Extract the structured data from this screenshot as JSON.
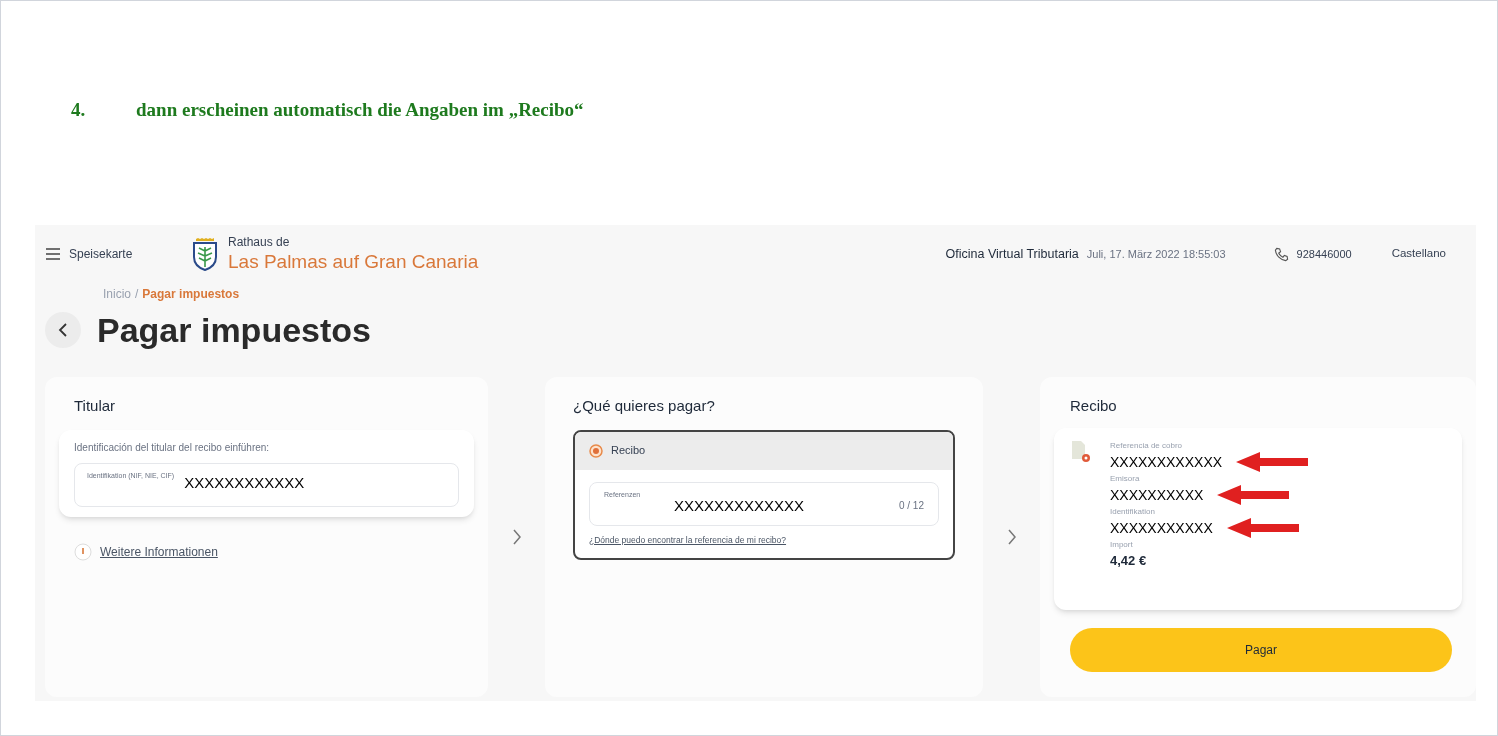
{
  "heading": {
    "number": "4.",
    "text": "dann erscheinen automatisch die Angaben im „Recibo“"
  },
  "header": {
    "menu_label": "Speisekarte",
    "logo_top": "Rathaus de",
    "logo_name": "Las Palmas auf Gran Canaria",
    "office": "Oficina Virtual Tributaria",
    "datetime": "Juli, 17. März 2022 18:55:03",
    "phone": "928446000",
    "language": "Castellano"
  },
  "breadcrumb_separator": "/",
  "breadcrumb": [
    {
      "label": "Inicio",
      "selected": false
    },
    {
      "label": "Pagar impuestos",
      "selected": true
    }
  ],
  "page_title": "Pagar impuestos",
  "titular": {
    "title": "Titular",
    "prompt": "Identificación del titular del recibo einführen:",
    "field_label": "Identifikation (NIF, NIE, CIF)",
    "value": "XXXXXXXXXXXX",
    "info_link": "Weitere Informationen"
  },
  "que_pagar": {
    "title": "¿Qué quieres pagar?",
    "option": {
      "label": "Recibo",
      "selected": true
    },
    "field_label": "Referenzen",
    "value": "XXXXXXXXXXXXX",
    "counter": "0 / 12",
    "help_link": "¿Dónde puedo encontrar la referencia de mi recibo?"
  },
  "recibo": {
    "title": "Recibo",
    "fields": [
      {
        "label": "Referencia de cobro",
        "value": "XXXXXXXXXXXX",
        "marked": true
      },
      {
        "label": "Emisora",
        "value": "XXXXXXXXXX",
        "marked": true
      },
      {
        "label": "Identifikation",
        "value": "XXXXXXXXXXX",
        "marked": true
      },
      {
        "label": "Import",
        "value": "4,42 €",
        "marked": false
      }
    ],
    "button": "Pagar"
  }
}
